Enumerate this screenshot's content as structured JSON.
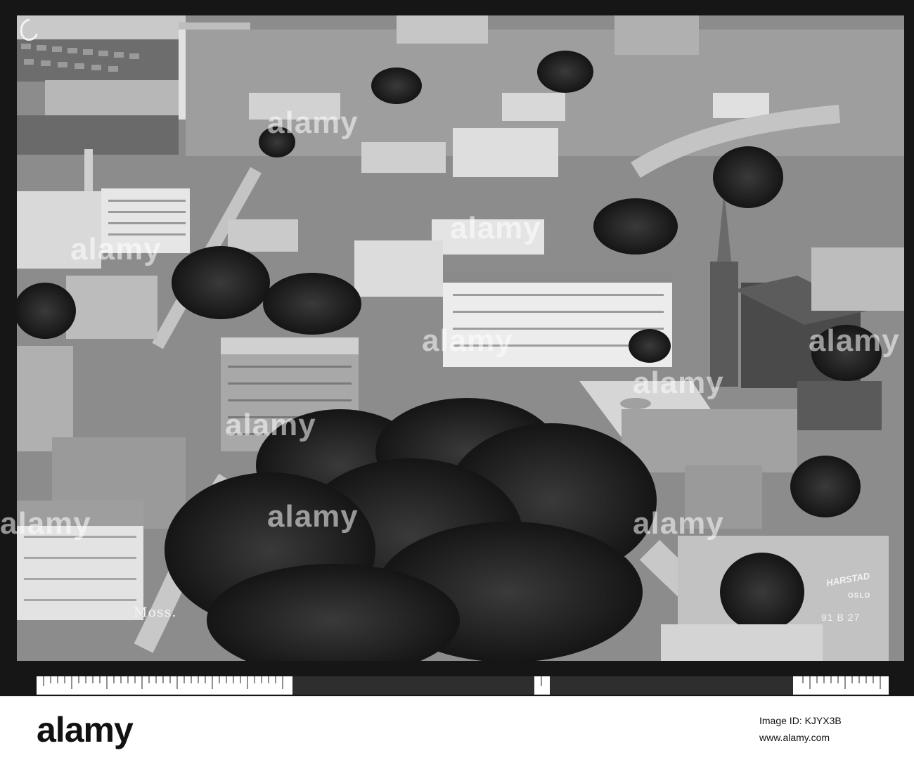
{
  "photo": {
    "caption": "Moss.",
    "publisher_name": "HARSTAD",
    "publisher_city": "OSLO",
    "reference_code": "91 B 27",
    "tone": "#7d7d7d"
  },
  "watermark": {
    "word": "alamy"
  },
  "footer": {
    "logo": "alamy",
    "image_id": "Image ID: KJYX3B",
    "site": "www.alamy.com"
  },
  "colors": {
    "frame": "#161616",
    "footer_bg": "#ffffff",
    "photo_tone": "#7d7d7d"
  }
}
